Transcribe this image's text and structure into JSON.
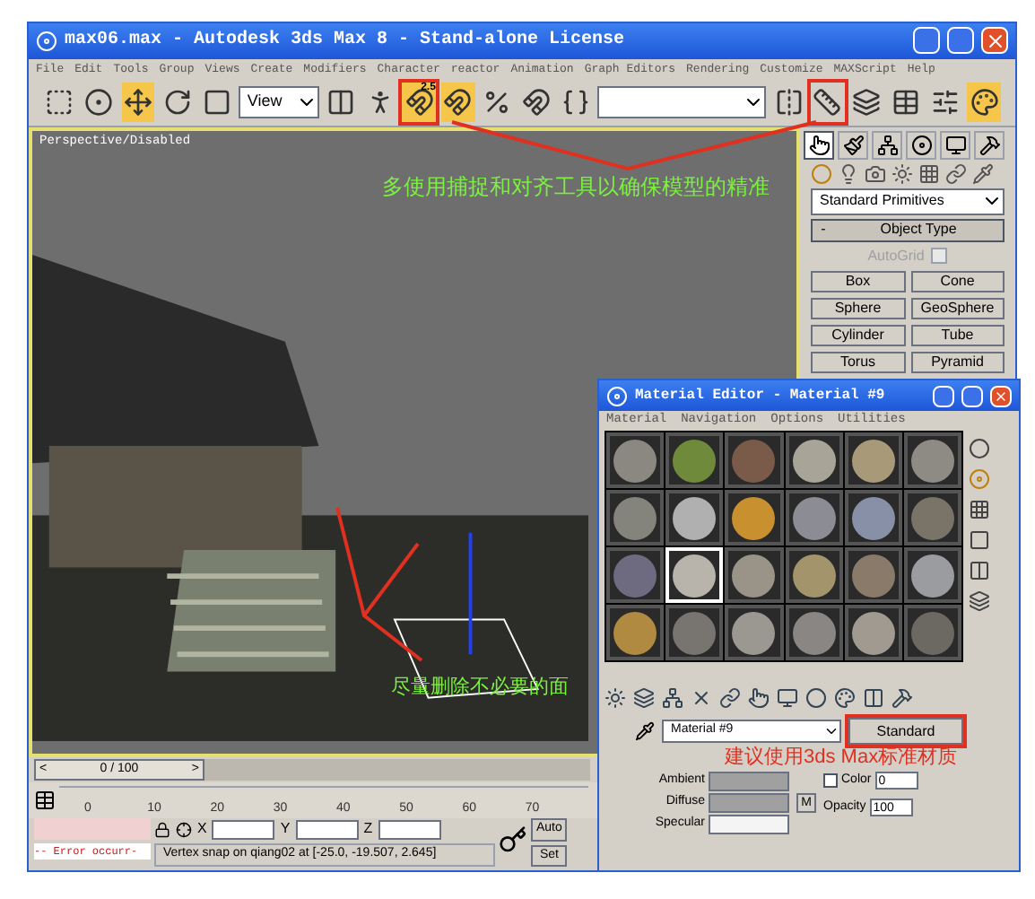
{
  "window": {
    "title": "max06.max  -  Autodesk 3ds Max 8  - Stand-alone License"
  },
  "menu": [
    "File",
    "Edit",
    "Tools",
    "Group",
    "Views",
    "Create",
    "Modifiers",
    "Character",
    "reactor",
    "Animation",
    "Graph Editors",
    "Rendering",
    "Customize",
    "MAXScript",
    "Help"
  ],
  "toolbar": [
    {
      "kind": "tool",
      "active": false,
      "marked": false
    },
    {
      "kind": "tool",
      "active": false,
      "marked": false
    },
    {
      "kind": "tool",
      "active": true,
      "marked": false
    },
    {
      "kind": "tool",
      "active": false,
      "marked": false
    },
    {
      "kind": "tool",
      "active": false,
      "marked": false
    },
    {
      "kind": "dropdown",
      "value": "View"
    },
    {
      "kind": "tool",
      "active": false,
      "marked": false
    },
    {
      "kind": "tool",
      "active": false,
      "marked": false
    },
    {
      "kind": "tool",
      "active": true,
      "marked": true,
      "label": "2.5"
    },
    {
      "kind": "tool",
      "active": true,
      "marked": false
    },
    {
      "kind": "tool",
      "active": false,
      "marked": false
    },
    {
      "kind": "tool",
      "active": false,
      "marked": false
    },
    {
      "kind": "tool",
      "active": false,
      "marked": false
    },
    {
      "kind": "dropdown"
    },
    {
      "kind": "tool",
      "active": false,
      "marked": false
    },
    {
      "kind": "tool",
      "active": false,
      "marked": true
    },
    {
      "kind": "tool",
      "active": false,
      "marked": false
    },
    {
      "kind": "tool",
      "active": false,
      "marked": false
    },
    {
      "kind": "tool",
      "active": false,
      "marked": false
    },
    {
      "kind": "tool",
      "active": true,
      "marked": false
    }
  ],
  "viewport": {
    "label": "Perspective/Disabled",
    "annotations": [
      {
        "text": "多使用捕捉和对齐工具以确保模型的精准",
        "kind": "top"
      },
      {
        "text": "尽量删除不必要的面",
        "kind": "bottom"
      }
    ]
  },
  "command_panel": {
    "tabs": [
      {
        "selected": true
      },
      {
        "selected": false
      },
      {
        "selected": false
      },
      {
        "selected": false
      },
      {
        "selected": false
      },
      {
        "selected": false
      }
    ],
    "category": "Standard Primitives",
    "rollout": {
      "toggle": "-",
      "title": "Object Type"
    },
    "autogrid": {
      "label": "AutoGrid",
      "checked": false,
      "disabled": true
    },
    "buttons": [
      "Box",
      "Cone",
      "Sphere",
      "GeoSphere",
      "Cylinder",
      "Tube",
      "Torus",
      "Pyramid"
    ]
  },
  "time_slider": {
    "level": 0,
    "prev": "<",
    "position": "0 / 100",
    "next": ">"
  },
  "track": {
    "ticks": [
      "0",
      "10",
      "20",
      "30",
      "40",
      "50",
      "60",
      "70"
    ]
  },
  "status": {
    "error": "-- Error occurr-",
    "x_label": "X",
    "y_label": "Y",
    "z_label": "Z",
    "prompt": "Vertex snap on qiang02 at [-25.0, -19.507, 2.645]",
    "auto_key": "Auto",
    "set_key": "Set"
  },
  "material_editor": {
    "title": "Material Editor - Material #9",
    "menu": [
      "Material",
      "Navigation",
      "Options",
      "Utilities"
    ],
    "spheres": [
      {
        "color": "#8a8880",
        "selected": false
      },
      {
        "color": "#6f8a3a",
        "selected": false
      },
      {
        "color": "#7a5a48",
        "selected": false
      },
      {
        "color": "#a8a498",
        "selected": false
      },
      {
        "color": "#a89a78",
        "selected": false
      },
      {
        "color": "#8e8a84",
        "selected": false
      },
      {
        "color": "#84847c",
        "selected": false
      },
      {
        "color": "#b0b0b0",
        "selected": false
      },
      {
        "color": "#c8902e",
        "selected": false
      },
      {
        "color": "#8c8c94",
        "selected": false
      },
      {
        "color": "#8890a8",
        "selected": false
      },
      {
        "color": "#7a7468",
        "selected": false
      },
      {
        "color": "#6e6a80",
        "selected": false
      },
      {
        "color": "#b8b4ac",
        "selected": true
      },
      {
        "color": "#9a9488",
        "selected": false
      },
      {
        "color": "#a4946c",
        "selected": false
      },
      {
        "color": "#8a7a6a",
        "selected": false
      },
      {
        "color": "#9a9ca0",
        "selected": false
      },
      {
        "color": "#b08a40",
        "selected": false
      },
      {
        "color": "#787470",
        "selected": false
      },
      {
        "color": "#9a9890",
        "selected": false
      },
      {
        "color": "#8a8684",
        "selected": false
      },
      {
        "color": "#a09a90",
        "selected": false
      },
      {
        "color": "#6c6862",
        "selected": false
      }
    ],
    "material_name": "Material #9",
    "type_button": "Standard",
    "annotation": "建议使用3ds Max标准材质",
    "colors": [
      {
        "label": "Ambient",
        "color": "#a0a0a0"
      },
      {
        "label": "Diffuse",
        "color": "#a0a0a0"
      },
      {
        "label": "Specular",
        "color": "#f4f4f4"
      }
    ],
    "map_button": "M",
    "self_illum": {
      "label": "Color",
      "checked": false,
      "value": "0"
    },
    "opacity": {
      "label": "Opacity",
      "value": "100"
    }
  }
}
